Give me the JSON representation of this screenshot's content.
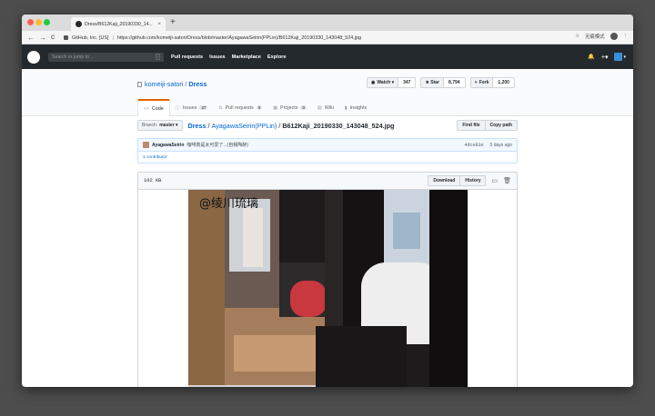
{
  "browser": {
    "tab_title": "Dress/B612Kaji_20190330_14...",
    "tab_close": "×",
    "new_tab": "+",
    "back": "←",
    "forward": "→",
    "reload": "C",
    "site_identity": "GitHub, Inc. [US]",
    "separator": "|",
    "url": "https://github.com/komeiji-satori/Dress/blob/master/AyagawaSeirin(PPLin)/B612Kaji_20190330_143048_524.jpg",
    "bookmark": "☆",
    "incognito_label": "无痕模式",
    "menu": "⋮"
  },
  "gh": {
    "search_placeholder": "Search or jump to...",
    "slash": "/",
    "nav": [
      "Pull requests",
      "Issues",
      "Marketplace",
      "Explore"
    ],
    "bell": "🔔",
    "plus": "+▾",
    "avatar_caret": "▾"
  },
  "repo": {
    "owner": "komeiji-satori",
    "slash": "/",
    "name": "Dress",
    "watch_label": "Watch ▾",
    "watch_count": "347",
    "star_label": "★ Star",
    "star_count": "8,794",
    "fork_label": "Fork",
    "fork_count": "1,200",
    "tabs": [
      {
        "icon": "<>",
        "label": "Code",
        "count": ""
      },
      {
        "icon": "ⓘ",
        "label": "Issues",
        "count": "37"
      },
      {
        "icon": "⇅",
        "label": "Pull requests",
        "count": "0"
      },
      {
        "icon": "▦",
        "label": "Projects",
        "count": "0"
      },
      {
        "icon": "▤",
        "label": "Wiki",
        "count": ""
      },
      {
        "icon": "▮",
        "label": "Insights",
        "count": ""
      }
    ]
  },
  "file": {
    "branch_label": "Branch:",
    "branch_value": "master ▾",
    "crumb_repo": "Dress",
    "crumb_sep": "/",
    "crumb_dir": "AyagawaSeirin(PPLin)",
    "crumb_file": "B612Kaji_20190330_143048_524.jpg",
    "find_file": "Find file",
    "copy_path": "Copy path",
    "commit_author": "AyagawaSeirin",
    "commit_message": "咖啡真是太可爱了...(自我陶醉)",
    "commit_sha": "4dce83e",
    "commit_time": "5 days ago",
    "contributor": "1 contributor",
    "size": "102 KB",
    "download": "Download",
    "history": "History",
    "watermark": "@绫川琉璃"
  },
  "colors": {
    "header_bg": "#24292e",
    "link": "#0366d6",
    "accent_tab": "#e36209"
  }
}
